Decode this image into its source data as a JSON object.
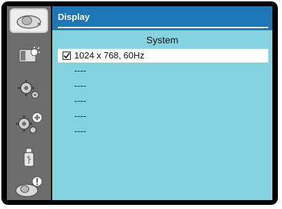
{
  "header": {
    "title": "Display"
  },
  "section": {
    "title": "System"
  },
  "rows": [
    {
      "label": "1024 x 768, 60Hz",
      "checked": true
    },
    {
      "label": "----"
    },
    {
      "label": "----"
    },
    {
      "label": "----"
    },
    {
      "label": "----"
    },
    {
      "label": "----"
    }
  ],
  "sidebar": {
    "items": [
      {
        "icon": "projector-icon",
        "active": true
      },
      {
        "icon": "picture-adjust-icon"
      },
      {
        "icon": "gear-icon"
      },
      {
        "icon": "advanced-gear-icon"
      },
      {
        "icon": "usb-drive-icon"
      },
      {
        "icon": "projector-info-icon"
      }
    ]
  },
  "colors": {
    "frame": "#000000",
    "sidebar": "#6d6d6d",
    "header": "#1c76b8",
    "content": "#85d3df",
    "selected_row": "#ffffff"
  }
}
